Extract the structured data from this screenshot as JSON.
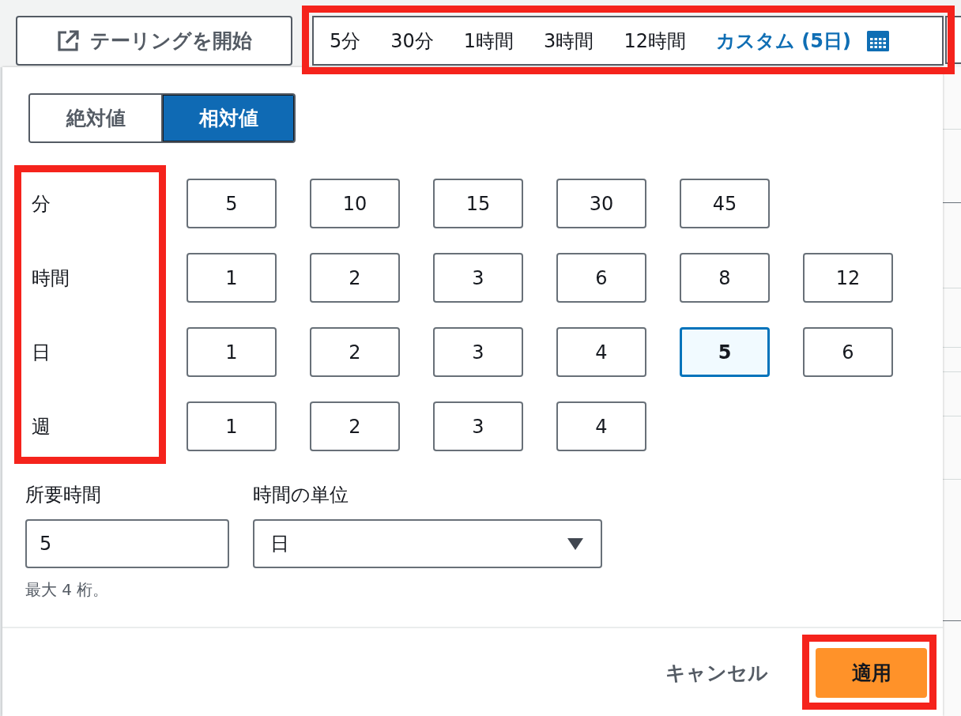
{
  "tailing_button": {
    "label": "テーリングを開始"
  },
  "range_selector": {
    "highlighted": true,
    "options": [
      {
        "kind": "preset",
        "label": "5分",
        "selected": false
      },
      {
        "kind": "preset",
        "label": "30分",
        "selected": false
      },
      {
        "kind": "preset",
        "label": "1時間",
        "selected": false
      },
      {
        "kind": "preset",
        "label": "3時間",
        "selected": false
      },
      {
        "kind": "preset",
        "label": "12時間",
        "selected": false
      },
      {
        "kind": "custom",
        "label": "カスタム (5日)",
        "selected": true
      }
    ]
  },
  "popup": {
    "mode_toggle": [
      {
        "label": "絶対値",
        "selected": false
      },
      {
        "label": "相対値",
        "selected": true
      }
    ],
    "unit_labels_highlighted": true,
    "unit_rows": [
      {
        "label": "分",
        "options": [
          {
            "label": "5",
            "selected": false
          },
          {
            "label": "10",
            "selected": false
          },
          {
            "label": "15",
            "selected": false
          },
          {
            "label": "30",
            "selected": false
          },
          {
            "label": "45",
            "selected": false
          }
        ]
      },
      {
        "label": "時間",
        "options": [
          {
            "label": "1",
            "selected": false
          },
          {
            "label": "2",
            "selected": false
          },
          {
            "label": "3",
            "selected": false
          },
          {
            "label": "6",
            "selected": false
          },
          {
            "label": "8",
            "selected": false
          },
          {
            "label": "12",
            "selected": false
          }
        ]
      },
      {
        "label": "日",
        "options": [
          {
            "label": "1",
            "selected": false
          },
          {
            "label": "2",
            "selected": false
          },
          {
            "label": "3",
            "selected": false
          },
          {
            "label": "4",
            "selected": false
          },
          {
            "label": "5",
            "selected": true
          },
          {
            "label": "6",
            "selected": false
          }
        ]
      },
      {
        "label": "週",
        "options": [
          {
            "label": "1",
            "selected": false
          },
          {
            "label": "2",
            "selected": false
          },
          {
            "label": "3",
            "selected": false
          },
          {
            "label": "4",
            "selected": false
          }
        ]
      }
    ],
    "duration": {
      "label": "所要時間",
      "value": "5",
      "hint": "最大 4 桁。"
    },
    "time_unit": {
      "label": "時間の単位",
      "value": "日"
    },
    "cancel_button": {
      "label": "キャンセル"
    },
    "apply_button": {
      "label": "適用",
      "highlighted": true
    }
  }
}
